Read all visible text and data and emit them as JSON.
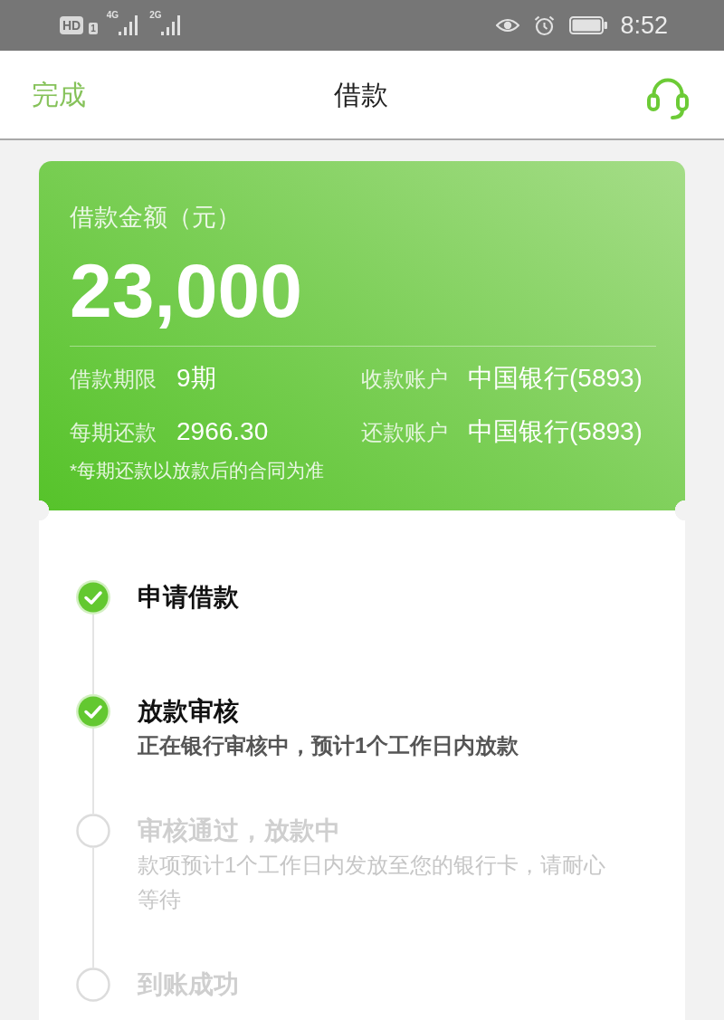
{
  "status_bar": {
    "hd_badge": "HD",
    "sim_badge": "1",
    "signals": [
      {
        "label": "4G"
      },
      {
        "label": "2G"
      }
    ],
    "time": "8:52"
  },
  "nav_bar": {
    "left_action": "完成",
    "title": "借款"
  },
  "loan_card": {
    "amount_label": "借款金额（元）",
    "amount": "23,000",
    "details": [
      {
        "label": "借款期限",
        "value": "9期"
      },
      {
        "label": "收款账户",
        "value": "中国银行(5893)"
      },
      {
        "label": "每期还款",
        "value": "2966.30"
      },
      {
        "label": "还款账户",
        "value": "中国银行(5893)"
      }
    ],
    "note": "*每期还款以放款后的合同为准"
  },
  "steps": [
    {
      "title": "申请借款",
      "done": true
    },
    {
      "title": "放款审核",
      "description": "正在银行审核中，预计1个工作日内放款",
      "done": true
    },
    {
      "title": "审核通过，放款中",
      "description": "款项预计1个工作日内发放至您的银行卡，请耐心等待",
      "done": false
    },
    {
      "title": "到账成功",
      "done": false
    }
  ]
}
